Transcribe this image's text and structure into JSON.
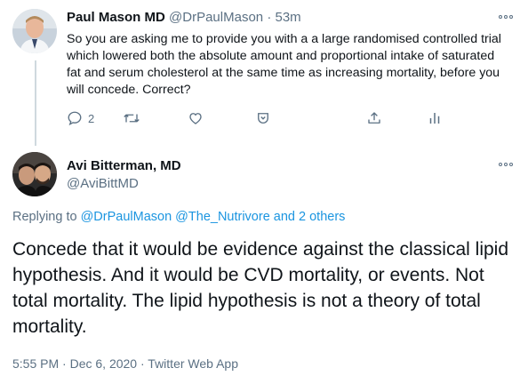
{
  "parent_tweet": {
    "display_name": "Paul Mason MD",
    "handle": "@DrPaulMason",
    "separator": "·",
    "time": "53m",
    "text": "So you are asking me to provide you with a a large randomised controlled trial which lowered both the absolute amount and proportional intake of saturated fat and serum cholesterol at the same time as increasing mortality, before you will concede. Correct?",
    "reply_count": "2",
    "icons": [
      "reply-icon",
      "retweet-icon",
      "like-icon",
      "tip-icon",
      "share-icon",
      "analytics-icon"
    ]
  },
  "main_tweet": {
    "display_name": "Avi Bitterman, MD",
    "handle": "@AviBittMD",
    "replying_prefix": "Replying to",
    "replying_user1": "@DrPaulMason",
    "replying_user2": "@The_Nutrivore",
    "replying_others": "and 2 others",
    "text": "Concede that it would be evidence against the classical lipid hypothesis. And it would be CVD mortality, or events. Not total mortality. The lipid hypothesis is not a theory of total mortality.",
    "time": "5:55 PM",
    "date": "Dec 6, 2020",
    "source": "Twitter Web App",
    "separator": "·"
  },
  "colors": {
    "link": "#1b95e0",
    "secondary_text": "#5b7083",
    "primary_text": "#0f1419",
    "thread_line": "#cfd9de"
  }
}
